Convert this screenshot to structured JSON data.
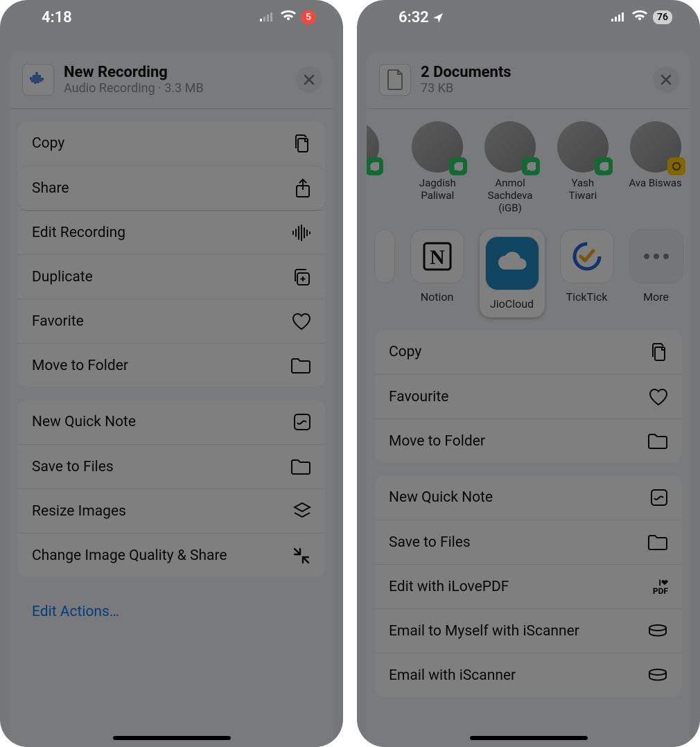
{
  "left": {
    "status": {
      "time": "4:18",
      "battery": "5"
    },
    "header": {
      "title": "New Recording",
      "subtitle": "Audio Recording · 3.3 MB"
    },
    "groups": [
      [
        {
          "label": "Copy",
          "icon": "copy"
        },
        {
          "label": "Share",
          "icon": "share",
          "highlight": true
        },
        {
          "label": "Edit Recording",
          "icon": "waveform"
        },
        {
          "label": "Duplicate",
          "icon": "duplicate"
        },
        {
          "label": "Favorite",
          "icon": "heart"
        },
        {
          "label": "Move to Folder",
          "icon": "folder"
        }
      ],
      [
        {
          "label": "New Quick Note",
          "icon": "note"
        },
        {
          "label": "Save to Files",
          "icon": "folder"
        },
        {
          "label": "Resize Images",
          "icon": "layers"
        },
        {
          "label": "Change Image Quality & Share",
          "icon": "compress"
        }
      ],
      [
        {
          "label": "Edit Actions…",
          "link": true
        }
      ]
    ]
  },
  "right": {
    "status": {
      "time": "6:32",
      "battery": "76"
    },
    "header": {
      "title": "2 Documents",
      "subtitle": "73 KB"
    },
    "people": [
      {
        "name": "Jagdish Paliwal",
        "badge": "whatsapp"
      },
      {
        "name": "Anmol Sachdeva (iGB)",
        "badge": "whatsapp"
      },
      {
        "name": "Yash Tiwari",
        "badge": "whatsapp"
      },
      {
        "name": "Ava Biswas",
        "badge": "messenger"
      }
    ],
    "apps": [
      {
        "name": "Notion",
        "icon": "notion"
      },
      {
        "name": "JioCloud",
        "icon": "jiocloud",
        "highlight": true
      },
      {
        "name": "TickTick",
        "icon": "ticktick"
      },
      {
        "name": "More",
        "icon": "more"
      }
    ],
    "groups": [
      [
        {
          "label": "Copy",
          "icon": "copy"
        },
        {
          "label": "Favourite",
          "icon": "heart"
        },
        {
          "label": "Move to Folder",
          "icon": "folder"
        }
      ],
      [
        {
          "label": "New Quick Note",
          "icon": "note"
        },
        {
          "label": "Save to Files",
          "icon": "folder"
        },
        {
          "label": "Edit with iLovePDF",
          "icon": "ilovepdf"
        },
        {
          "label": "Email to Myself with iScanner",
          "icon": "scanner"
        },
        {
          "label": "Email with iScanner",
          "icon": "scanner"
        }
      ]
    ]
  }
}
